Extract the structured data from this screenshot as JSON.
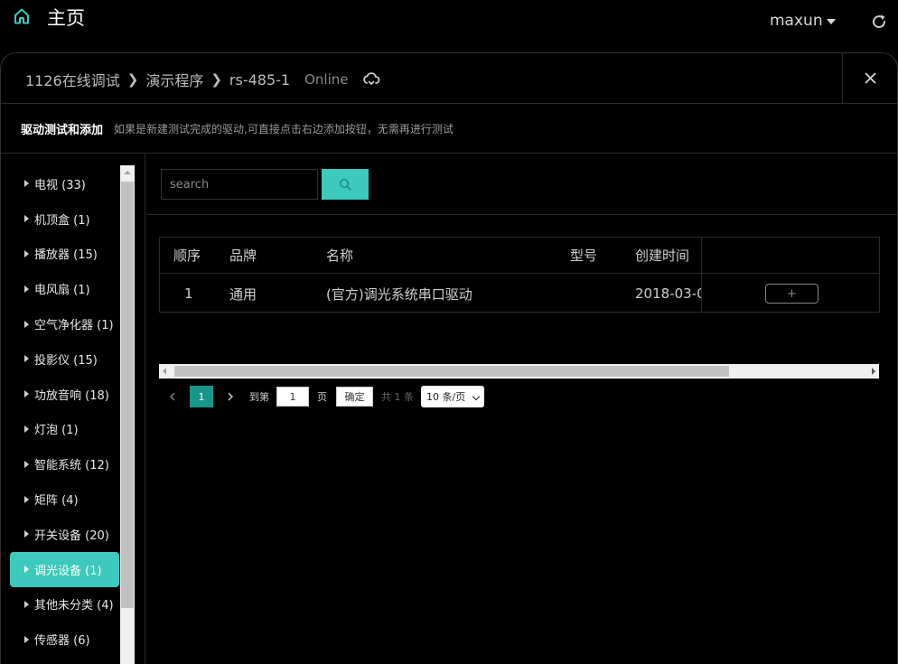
{
  "topbar": {
    "title": "主页",
    "user": "maxun"
  },
  "breadcrumb": {
    "items": [
      "1126在线调试",
      "演示程序",
      "rs-485-1"
    ],
    "status": "Online"
  },
  "subheader": {
    "title": "驱动测试和添加",
    "hint": "如果是新建测试完成的驱动,可直接点击右边添加按钮，无需再进行测试"
  },
  "categories": [
    {
      "label": "电视 (33)"
    },
    {
      "label": "机顶盒 (1)"
    },
    {
      "label": "播放器 (15)"
    },
    {
      "label": "电风扇 (1)"
    },
    {
      "label": "空气净化器 (1)"
    },
    {
      "label": "投影仪 (15)"
    },
    {
      "label": "功放音响 (18)"
    },
    {
      "label": "灯泡 (1)"
    },
    {
      "label": "智能系统 (12)"
    },
    {
      "label": "矩阵 (4)"
    },
    {
      "label": "开关设备 (20)"
    },
    {
      "label": "调光设备 (1)",
      "active": true
    },
    {
      "label": "其他未分类 (4)"
    },
    {
      "label": "传感器 (6)"
    }
  ],
  "search": {
    "placeholder": "search"
  },
  "table": {
    "headers": [
      "顺序",
      "品牌",
      "名称",
      "型号",
      "创建时间"
    ],
    "rows": [
      {
        "index": "1",
        "brand": "通用",
        "name": "(官方)调光系统串口驱动",
        "model": "",
        "created": "2018-03-0",
        "action": "+"
      }
    ]
  },
  "pager": {
    "current_page": "1",
    "goto_label": "到第",
    "goto_value": "1",
    "page_unit": "页",
    "confirm_label": "确定",
    "total": "共 1 条",
    "page_size": "10 条/页"
  },
  "colors": {
    "accent": "#3dc9bb",
    "pager_active": "#17968b"
  }
}
